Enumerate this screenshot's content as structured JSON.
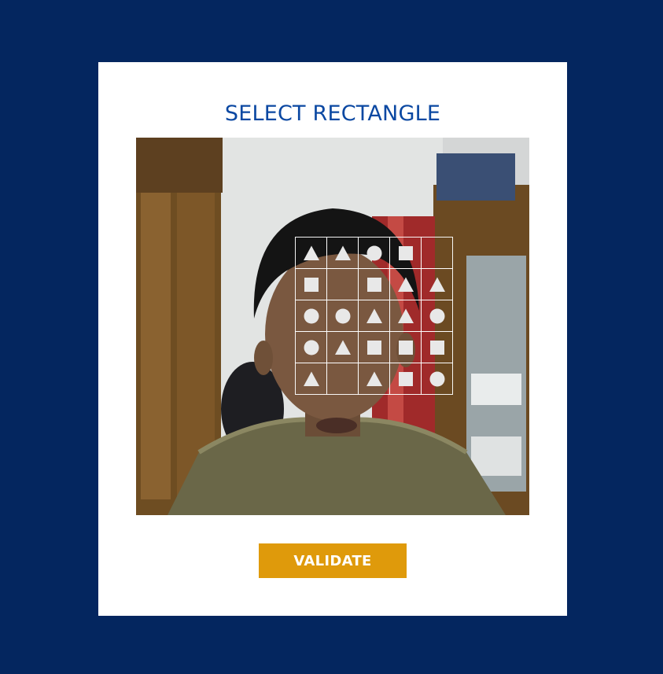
{
  "title": "SELECT RECTANGLE",
  "button": {
    "label": "VALIDATE"
  },
  "colors": {
    "page_background": "#04265f",
    "card_background": "#ffffff",
    "title": "#0b48a2",
    "button": "#df9a0b",
    "shape_fill": "#e8e8e8"
  },
  "grid": {
    "rows": 5,
    "cols": 5,
    "cells": [
      [
        "triangle",
        "triangle",
        "circle",
        "square",
        "empty"
      ],
      [
        "square",
        "empty",
        "square",
        "triangle",
        "triangle"
      ],
      [
        "circle",
        "circle",
        "triangle",
        "triangle",
        "circle"
      ],
      [
        "circle",
        "triangle",
        "square",
        "square",
        "square"
      ],
      [
        "triangle",
        "empty",
        "triangle",
        "square",
        "circle"
      ]
    ]
  }
}
